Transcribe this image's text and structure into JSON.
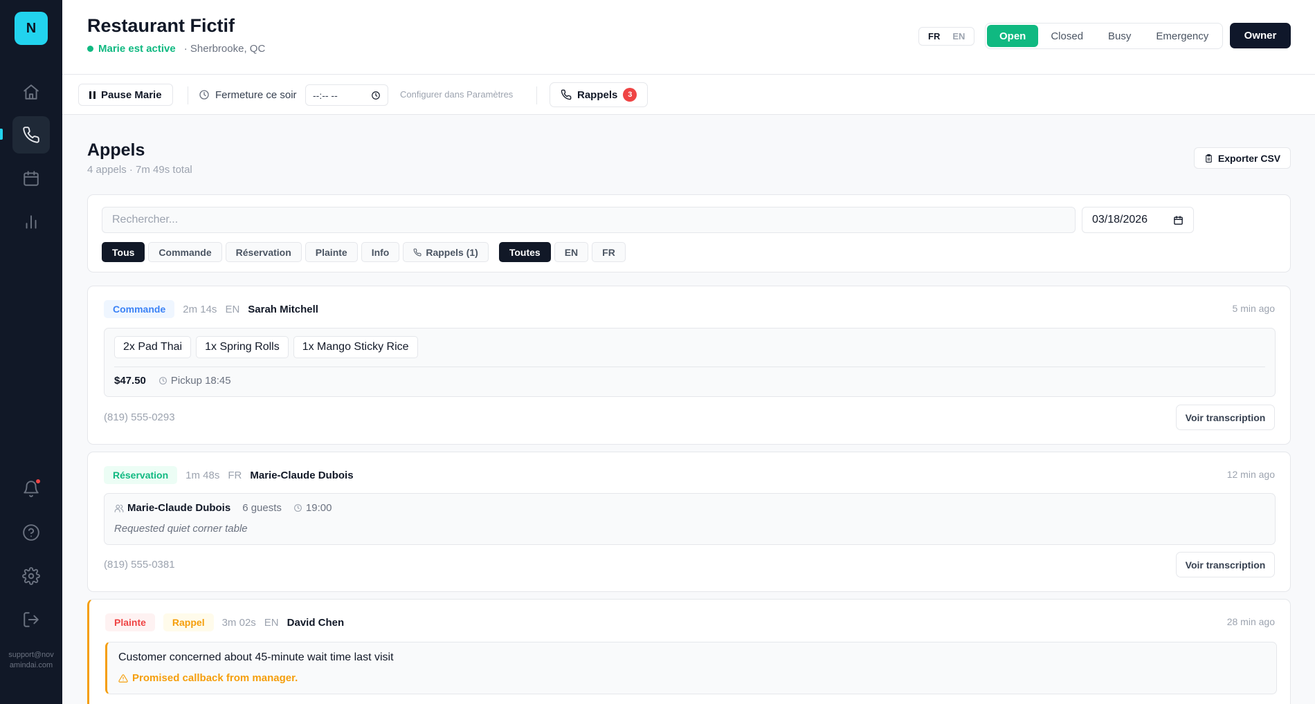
{
  "sidebar": {
    "logo_letter": "N",
    "support_email": "support@novamindai.com"
  },
  "header": {
    "title": "Restaurant Fictif",
    "agent_status": "Marie est active",
    "location": "· Sherbrooke, QC",
    "languages": [
      "FR",
      "EN"
    ],
    "status_options": [
      "Open",
      "Closed",
      "Busy",
      "Emergency"
    ],
    "owner_label": "Owner"
  },
  "toolbar": {
    "pause_label": "Pause Marie",
    "closing_label": "Fermeture ce soir",
    "time_value": "--:-- --",
    "configure_hint": "Configurer dans Paramètres",
    "callbacks_label": "Rappels",
    "callbacks_count": "3"
  },
  "main": {
    "title": "Appels",
    "summary": "4 appels · 7m 49s total",
    "export_label": "Exporter CSV",
    "search_placeholder": "Rechercher...",
    "date_value": "03/18/2026",
    "type_filters": [
      "Tous",
      "Commande",
      "Réservation",
      "Plainte",
      "Info",
      "Rappels (1)"
    ],
    "lang_filters": [
      "Toutes",
      "EN",
      "FR"
    ]
  },
  "calls": [
    {
      "type": "Commande",
      "duration": "2m 14s",
      "lang": "EN",
      "caller": "Sarah Mitchell",
      "ago": "5 min ago",
      "items": [
        "2x Pad Thai",
        "1x Spring Rolls",
        "1x Mango Sticky Rice"
      ],
      "total": "$47.50",
      "pickup": "Pickup 18:45",
      "phone": "(819) 555-0293",
      "transcript_label": "Voir transcription"
    },
    {
      "type": "Réservation",
      "duration": "1m 48s",
      "lang": "FR",
      "caller": "Marie-Claude Dubois",
      "ago": "12 min ago",
      "guest_name": "Marie-Claude Dubois",
      "guests": "6 guests",
      "time": "19:00",
      "note": "Requested quiet corner table",
      "phone": "(819) 555-0381",
      "transcript_label": "Voir transcription"
    },
    {
      "type": "Plainte",
      "tag2": "Rappel",
      "duration": "3m 02s",
      "lang": "EN",
      "caller": "David Chen",
      "ago": "28 min ago",
      "summary": "Customer concerned about 45-minute wait time last visit",
      "callback_note": "Promised callback from manager."
    }
  ],
  "colors": {
    "sidebar_bg": "#111827",
    "accent_cyan": "#22d3ee",
    "open_green": "#10b981",
    "order_blue": "#3b82f6",
    "complaint_red": "#ef4444",
    "callback_amber": "#f59e0b"
  }
}
